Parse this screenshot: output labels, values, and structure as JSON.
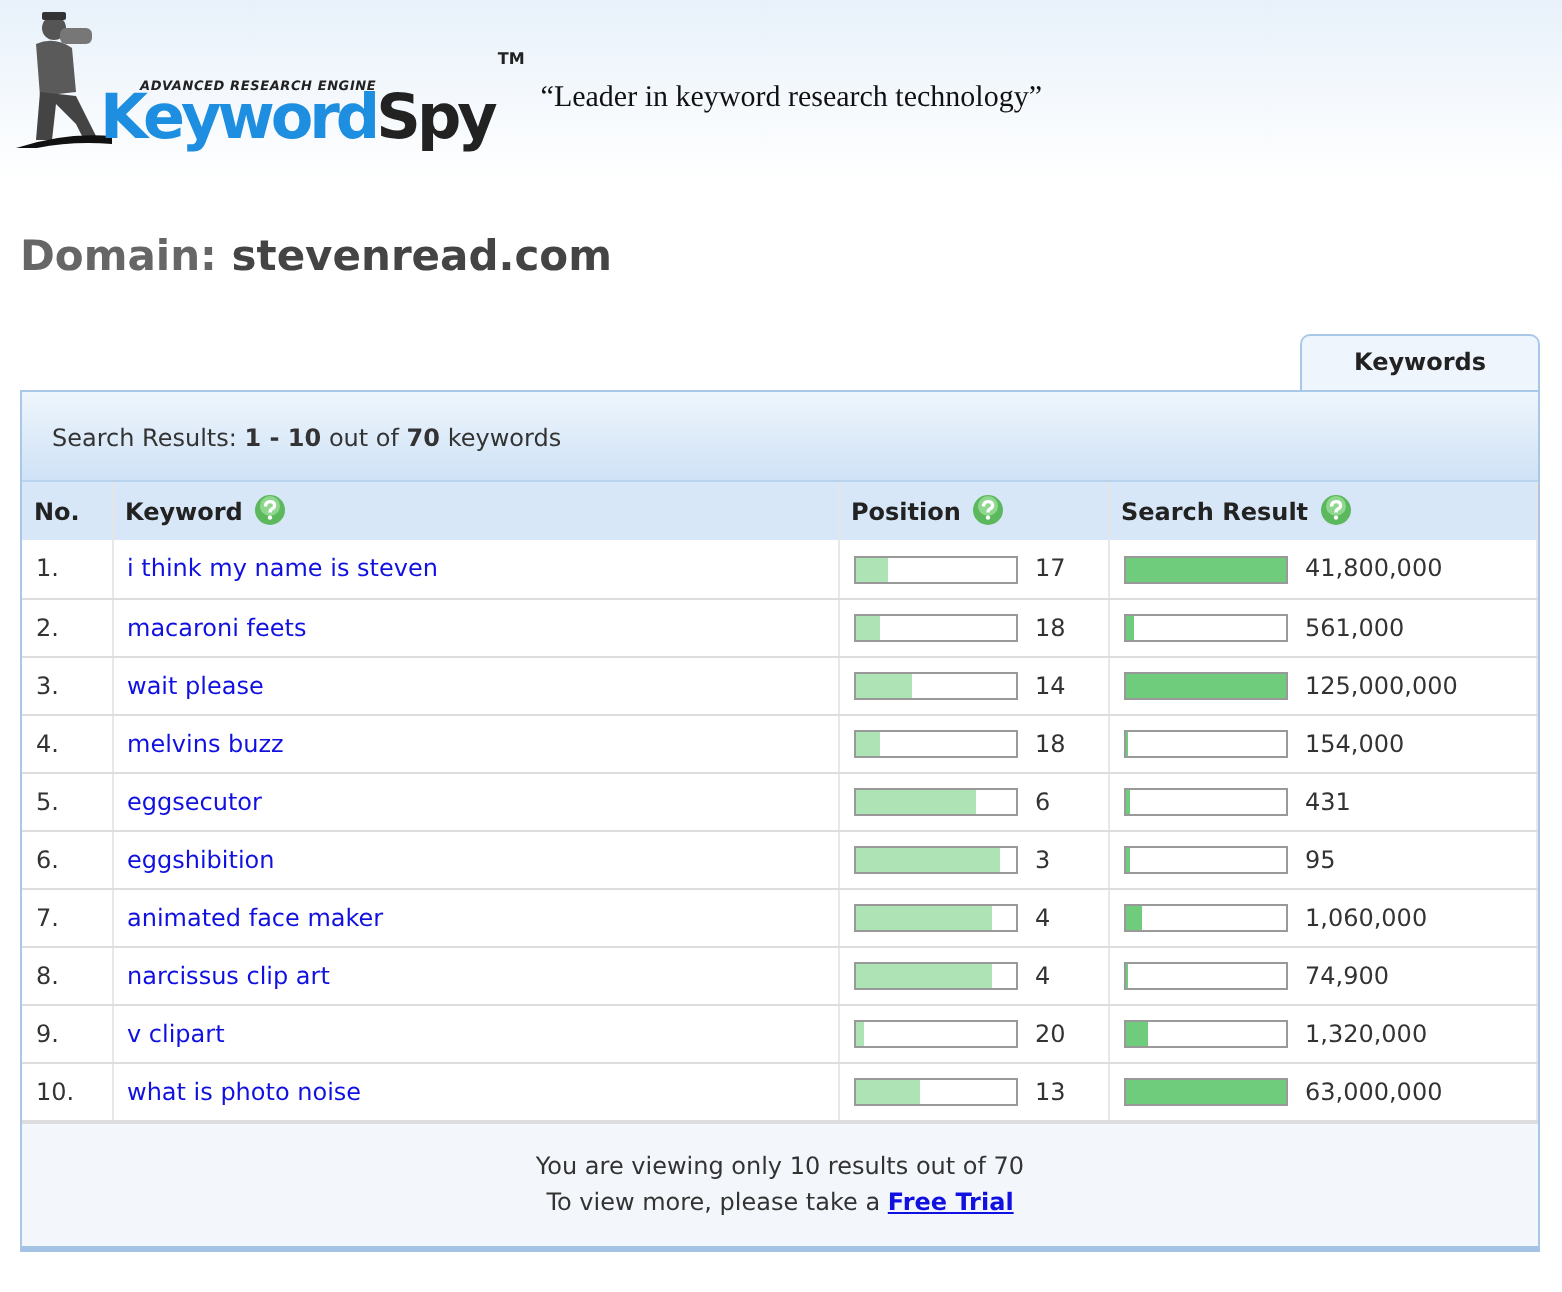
{
  "header": {
    "logo_small": "ADVANCED RESEARCH ENGINE",
    "logo_main": "Keyword",
    "logo_accent": "Spy",
    "trademark": "TM",
    "tagline": "“Leader in keyword research technology”"
  },
  "domain": {
    "label": "Domain:",
    "value": "stevenread.com"
  },
  "tabs": [
    {
      "label": "Keywords",
      "selected": true
    }
  ],
  "summary": "Search Results: **1 - 10** out of **70** keywords",
  "table": {
    "columns": [
      {
        "label": "No.",
        "help": false
      },
      {
        "label": "Keyword",
        "help": true
      },
      {
        "label": "Position",
        "help": true
      },
      {
        "label": "Search Result",
        "help": true
      }
    ],
    "rows": [
      {
        "no": "1.",
        "keyword": "i think my name is steven",
        "position": {
          "text": "17",
          "level": 0.2
        },
        "search_result": {
          "text": "41,800,000",
          "level": 1
        }
      },
      {
        "no": "2.",
        "keyword": "macaroni feets",
        "position": {
          "text": "18",
          "level": 0.15
        },
        "search_result": {
          "text": "561,000",
          "level": 0.06
        }
      },
      {
        "no": "3.",
        "keyword": "wait please",
        "position": {
          "text": "14",
          "level": 0.35
        },
        "search_result": {
          "text": "125,000,000",
          "level": 1
        }
      },
      {
        "no": "4.",
        "keyword": "melvins buzz",
        "position": {
          "text": "18",
          "level": 0.15
        },
        "search_result": {
          "text": "154,000",
          "level": 0.02
        }
      },
      {
        "no": "5.",
        "keyword": "eggsecutor",
        "position": {
          "text": "6",
          "level": 0.75
        },
        "search_result": {
          "text": "431",
          "level": 0.03
        }
      },
      {
        "no": "6.",
        "keyword": "eggshibition",
        "position": {
          "text": "3",
          "level": 0.9
        },
        "search_result": {
          "text": "95",
          "level": 0.03
        }
      },
      {
        "no": "7.",
        "keyword": "animated face maker",
        "position": {
          "text": "4",
          "level": 0.85
        },
        "search_result": {
          "text": "1,060,000",
          "level": 0.1
        }
      },
      {
        "no": "8.",
        "keyword": "narcissus clip art",
        "position": {
          "text": "4",
          "level": 0.85
        },
        "search_result": {
          "text": "74,900",
          "level": 0.02
        }
      },
      {
        "no": "9.",
        "keyword": "v clipart",
        "position": {
          "text": "20",
          "level": 0.05
        },
        "search_result": {
          "text": "1,320,000",
          "level": 0.14
        }
      },
      {
        "no": "10.",
        "keyword": "what is photo noise",
        "position": {
          "text": "13",
          "level": 0.4
        },
        "search_result": {
          "text": "63,000,000",
          "level": 1
        }
      }
    ]
  },
  "footer": {
    "line1": "You are viewing only 10 results out of 70",
    "line2": "To view more, please take a",
    "link": "Free Trial"
  }
}
